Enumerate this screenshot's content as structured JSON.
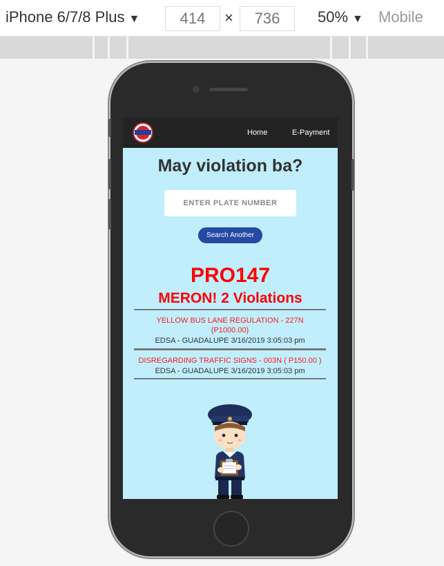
{
  "devtools": {
    "device": "iPhone 6/7/8 Plus",
    "width": "414",
    "times": "×",
    "height": "736",
    "zoom": "50%",
    "mode": "Mobile"
  },
  "nav": {
    "home": "Home",
    "epayment": "E-Payment"
  },
  "page": {
    "headline": "May violation ba?",
    "plate_placeholder": "ENTER PLATE NUMBER",
    "search_button": "Search Another",
    "plate": "PRO147",
    "summary": "MERON! 2 Violations"
  },
  "violations": [
    {
      "title": "YELLOW BUS LANE REGULATION - 227N",
      "amount": "(P1000.00)",
      "location": "EDSA - GUADALUPE 3/16/2019 3:05:03 pm"
    },
    {
      "title": "DISREGARDING TRAFFIC SIGNS - 003N ( P150.00 )",
      "location": "EDSA - GUADALUPE 3/16/2019 3:05:03 pm"
    }
  ],
  "colors": {
    "screen_bg": "#c0eefc",
    "nav_bg": "#232323",
    "alert_red": "#ff0000",
    "button_blue": "#244aa3"
  }
}
